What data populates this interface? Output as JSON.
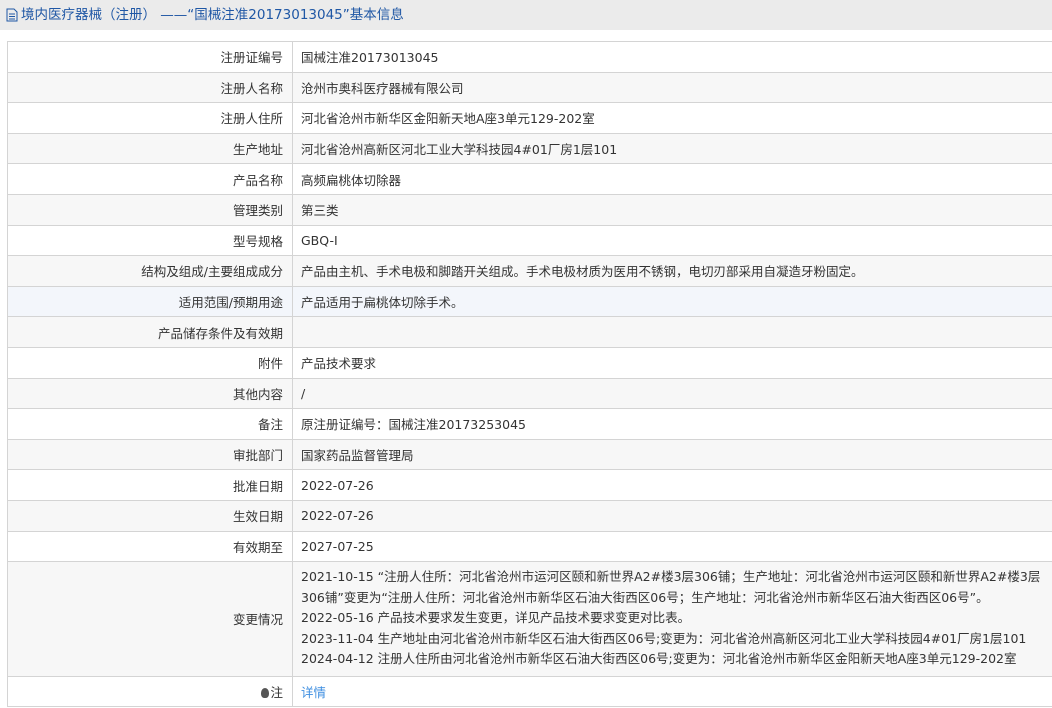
{
  "header": {
    "title": "境内医疗器械（注册） ——“国械注准20173013045”基本信息"
  },
  "rows": [
    {
      "label": "注册证编号",
      "value": "国械注准20173013045"
    },
    {
      "label": "注册人名称",
      "value": "沧州市奥科医疗器械有限公司"
    },
    {
      "label": "注册人住所",
      "value": "河北省沧州市新华区金阳新天地A座3单元129-202室"
    },
    {
      "label": "生产地址",
      "value": "河北省沧州高新区河北工业大学科技园4#01厂房1层101"
    },
    {
      "label": "产品名称",
      "value": "高频扁桃体切除器"
    },
    {
      "label": "管理类别",
      "value": "第三类"
    },
    {
      "label": "型号规格",
      "value": "GBQ-I"
    },
    {
      "label": "结构及组成/主要组成成分",
      "value": "产品由主机、手术电极和脚踏开关组成。手术电极材质为医用不锈钢，电切刃部采用自凝造牙粉固定。"
    },
    {
      "label": "适用范围/预期用途",
      "value": "产品适用于扁桃体切除手术。"
    },
    {
      "label": "产品储存条件及有效期",
      "value": ""
    },
    {
      "label": "附件",
      "value": "产品技术要求"
    },
    {
      "label": "其他内容",
      "value": "/"
    },
    {
      "label": "备注",
      "value": "原注册证编号：国械注准20173253045"
    },
    {
      "label": "审批部门",
      "value": "国家药品监督管理局"
    },
    {
      "label": "批准日期",
      "value": "2022-07-26"
    },
    {
      "label": "生效日期",
      "value": "2022-07-26"
    },
    {
      "label": "有效期至",
      "value": "2027-07-25"
    }
  ],
  "changes": {
    "label": "变更情况",
    "lines": [
      "2021-10-15 “注册人住所：河北省沧州市运河区颐和新世界A2#楼3层306铺；生产地址：河北省沧州市运河区颐和新世界A2#楼3层306铺”变更为“注册人住所：河北省沧州市新华区石油大街西区06号；生产地址：河北省沧州市新华区石油大街西区06号”。",
      "2022-05-16 产品技术要求发生变更，详见产品技术要求变更对比表。",
      "2023-11-04 生产地址由河北省沧州市新华区石油大街西区06号;变更为：河北省沧州高新区河北工业大学科技园4#01厂房1层101",
      "2024-04-12 注册人住所由河北省沧州市新华区石油大街西区06号;变更为：河北省沧州市新华区金阳新天地A座3单元129-202室"
    ]
  },
  "note": {
    "label": "注",
    "link": "详情"
  }
}
